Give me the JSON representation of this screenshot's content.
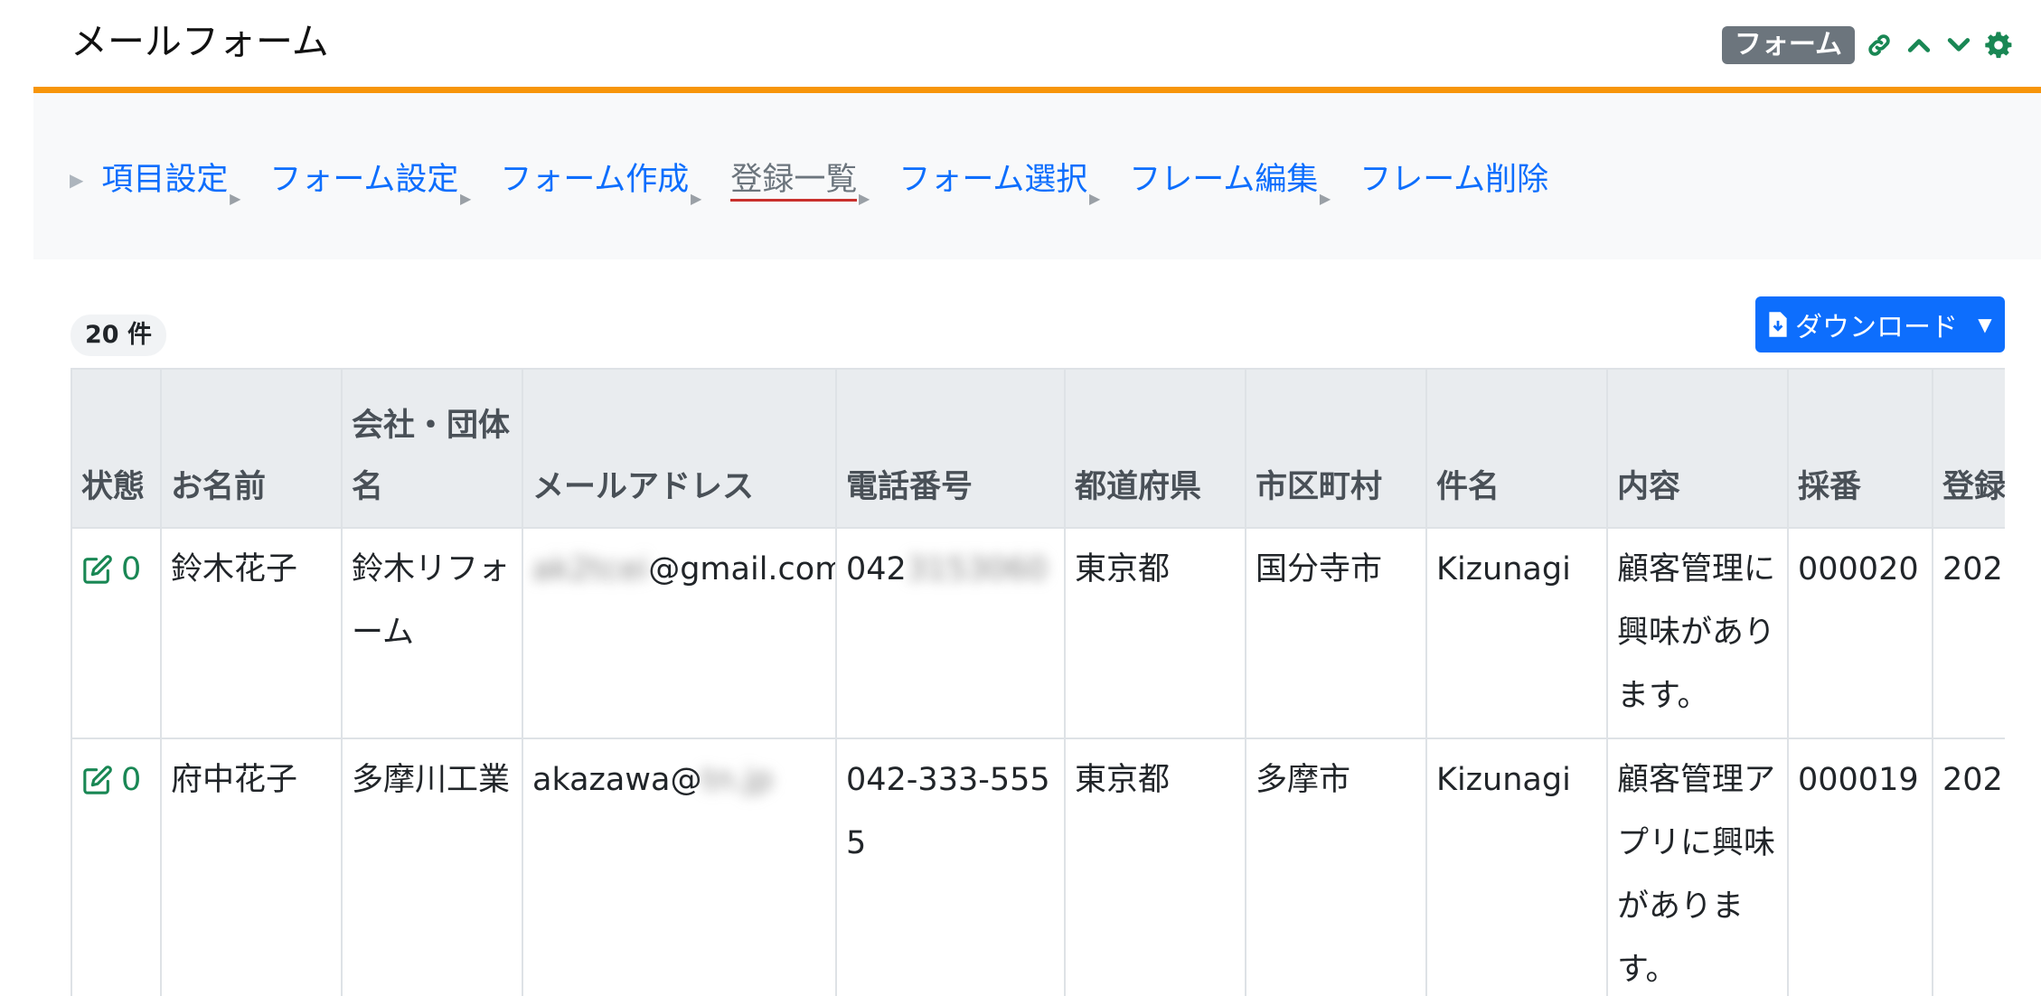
{
  "header": {
    "title": "メールフォーム",
    "badge": "フォーム",
    "icons": [
      "link-icon",
      "chevron-up-icon",
      "chevron-down-icon",
      "gear-icon"
    ]
  },
  "nav": {
    "items": [
      {
        "label": "項目設定",
        "current": false
      },
      {
        "label": "フォーム設定",
        "current": false
      },
      {
        "label": "フォーム作成",
        "current": false
      },
      {
        "label": "登録一覧",
        "current": true
      },
      {
        "label": "フォーム選択",
        "current": false
      },
      {
        "label": "フレーム編集",
        "current": false
      },
      {
        "label": "フレーム削除",
        "current": false
      }
    ]
  },
  "list": {
    "count": "20 件",
    "download_label": "ダウンロード"
  },
  "table": {
    "headers": [
      "状態",
      "お名前",
      "会社・団体名",
      "メールアドレス",
      "電話番号",
      "都道府県",
      "市区町村",
      "件名",
      "内容",
      "採番",
      "登録"
    ],
    "rows": [
      {
        "status": "0",
        "name": "鈴木花子",
        "company": "鈴木リフォーム",
        "email_hidden": "ak2tcei",
        "email_visible": "@gmail.com",
        "phone_visible": "042",
        "phone_hidden": "3153060",
        "prefecture": "東京都",
        "city": "国分寺市",
        "subject": "Kizunagi",
        "content": "顧客管理に興味があります。",
        "number": "000020",
        "registered": "202"
      },
      {
        "status": "0",
        "name": "府中花子",
        "company": "多摩川工業",
        "email_visible": "akazawa@",
        "email_hidden": "tn.jp",
        "phone_visible": "042-333-5555",
        "phone_hidden": "",
        "prefecture": "東京都",
        "city": "多摩市",
        "subject": "Kizunagi",
        "content": "顧客管理アプリに興味があります。",
        "number": "000019",
        "registered": "202"
      }
    ]
  },
  "colors": {
    "accent_orange": "#f7950a",
    "link_blue": "#0d6efd",
    "edit_green": "#198754",
    "tool_green": "#198754"
  }
}
